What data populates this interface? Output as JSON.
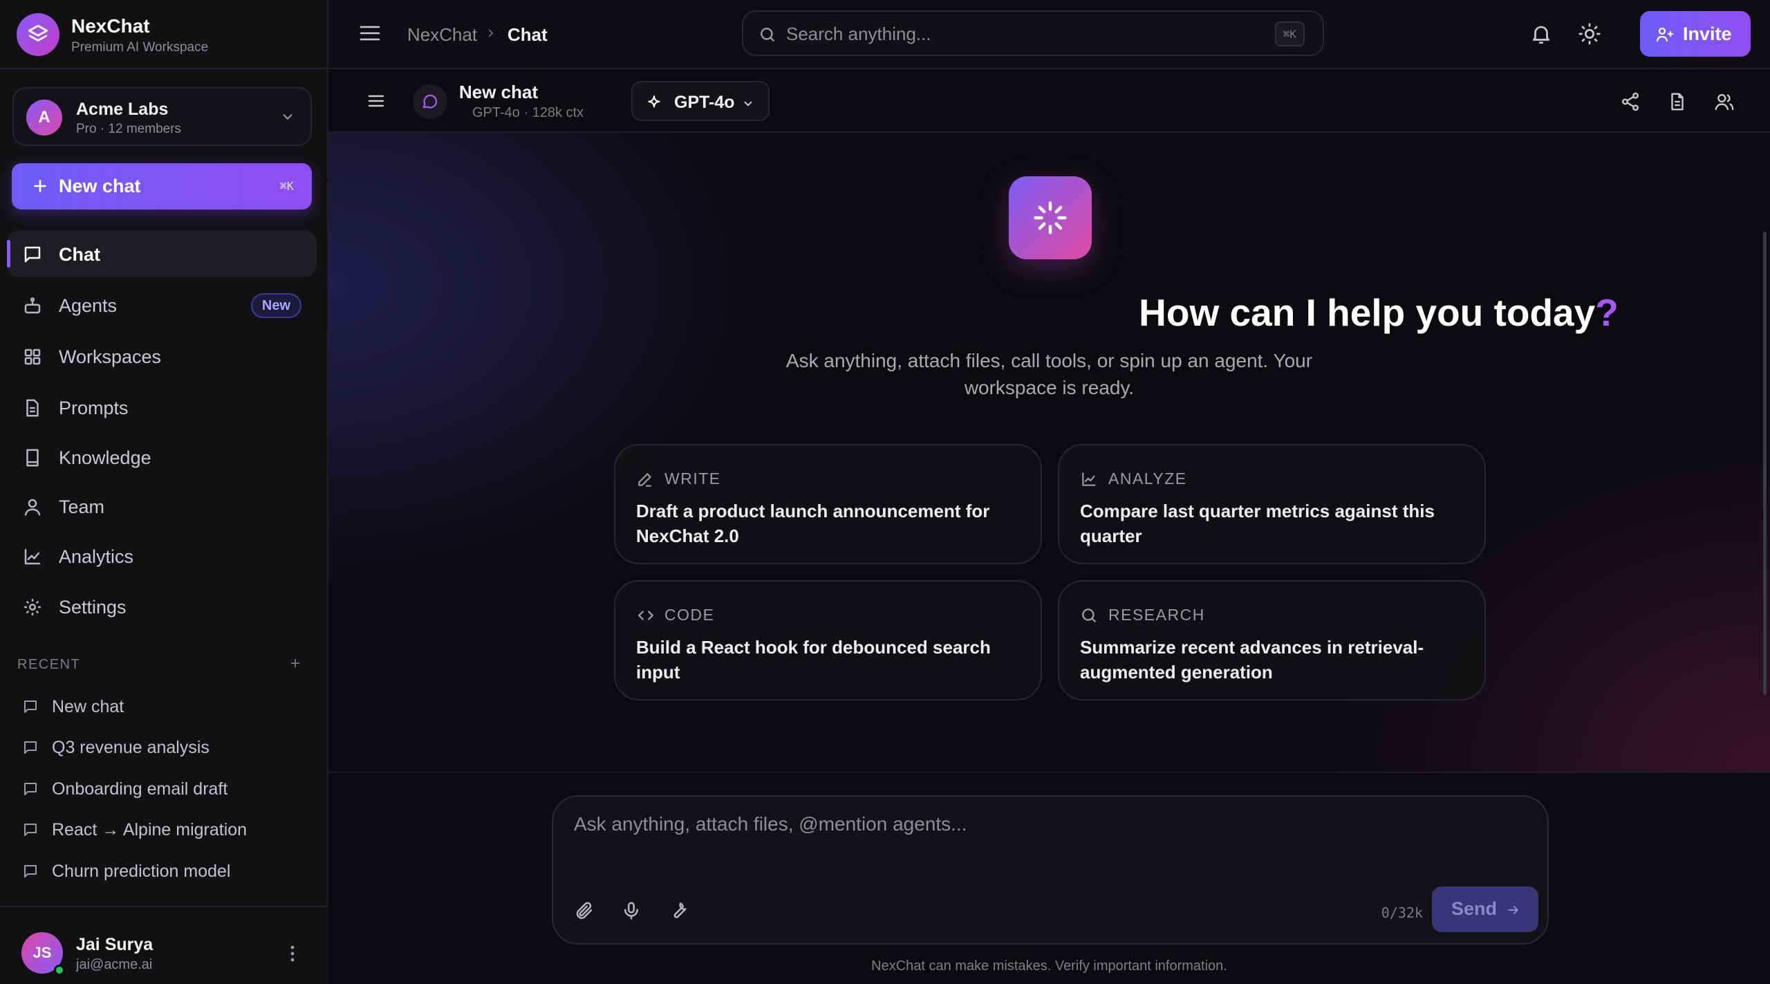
{
  "brand": {
    "name": "NexChat",
    "subtitle": "Premium AI Workspace",
    "logo_icon": "layers-icon"
  },
  "workspace": {
    "initial": "A",
    "name": "Acme Labs",
    "meta": "Pro · 12 members"
  },
  "new_chat": {
    "label": "New chat",
    "shortcut": "⌘K"
  },
  "nav": [
    {
      "label": "Chat",
      "icon": "message-square-icon",
      "active": true
    },
    {
      "label": "Agents",
      "icon": "bot-icon",
      "badge": "New"
    },
    {
      "label": "Workspaces",
      "icon": "grid-icon"
    },
    {
      "label": "Prompts",
      "icon": "file-text-icon"
    },
    {
      "label": "Knowledge",
      "icon": "book-icon"
    },
    {
      "label": "Team",
      "icon": "user-icon"
    },
    {
      "label": "Analytics",
      "icon": "line-chart-icon"
    },
    {
      "label": "Settings",
      "icon": "gear-icon"
    }
  ],
  "recent": {
    "header": "RECENT",
    "add": "+",
    "items": [
      "New chat",
      "Q3 revenue analysis",
      "Onboarding email draft",
      "React → Alpine migration",
      "Churn prediction model"
    ]
  },
  "user": {
    "initials": "JS",
    "name": "Jai Surya",
    "email": "jai@acme.ai",
    "status": "online"
  },
  "topbar": {
    "breadcrumb_root": "NexChat",
    "breadcrumb_current": "Chat",
    "search_placeholder": "Search anything...",
    "search_shortcut": "⌘K",
    "invite_label": "Invite"
  },
  "chat_header": {
    "title": "New chat",
    "subtitle": "GPT-4o · 128k ctx",
    "model": "GPT-4o"
  },
  "hero": {
    "title": "How can I help you today",
    "title_mark": "?",
    "subtitle": "Ask anything, attach files, call tools, or spin up an agent. Your workspace is ready."
  },
  "cards": [
    {
      "tag": "WRITE",
      "icon": "pen-icon",
      "text": "Draft a product launch announcement for NexChat 2.0"
    },
    {
      "tag": "ANALYZE",
      "icon": "line-chart-icon",
      "text": "Compare last quarter metrics against this quarter"
    },
    {
      "tag": "CODE",
      "icon": "code-icon",
      "text": "Build a React hook for debounced search input"
    },
    {
      "tag": "RESEARCH",
      "icon": "search-icon",
      "text": "Summarize recent advances in retrieval-augmented generation"
    }
  ],
  "composer": {
    "placeholder": "Ask anything, attach files, @mention agents...",
    "char_count": "0/32k",
    "send_label": "Send"
  },
  "disclaimer": "NexChat can make mistakes. Verify important information.",
  "colors": {
    "accent": "#8b5cf6",
    "accent_pink": "#e04aa0",
    "background": "#0b0b0f",
    "online": "#22c55e"
  }
}
